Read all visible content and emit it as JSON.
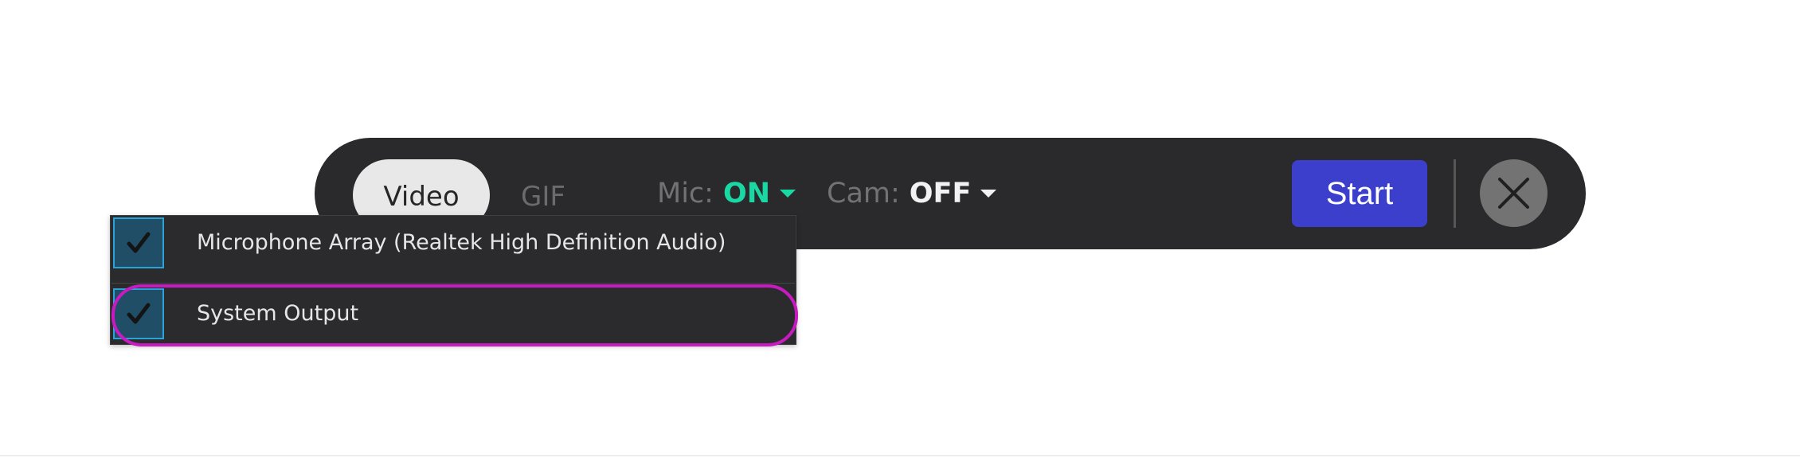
{
  "toolbar": {
    "modes": [
      "Video",
      "GIF"
    ],
    "selected_mode": "Video",
    "mic": {
      "label": "Mic:",
      "value": "ON"
    },
    "cam": {
      "label": "Cam:",
      "value": "OFF"
    },
    "start_label": "Start"
  },
  "mic_dropdown": {
    "items": [
      {
        "label": "Microphone Array (Realtek High Definition Audio)",
        "checked": true
      },
      {
        "label": "System Output",
        "checked": true
      }
    ]
  },
  "icons": {
    "close": "close-x-icon",
    "caret": "caret-down-icon",
    "check": "checkmark-icon"
  },
  "colors": {
    "toolbar_bg": "#2a2a2c",
    "mic_on": "#1ad8a4",
    "start_button": "#3b3fcb",
    "checkbox_border": "#2aa3d8",
    "highlight_ring": "#c71bc1"
  }
}
